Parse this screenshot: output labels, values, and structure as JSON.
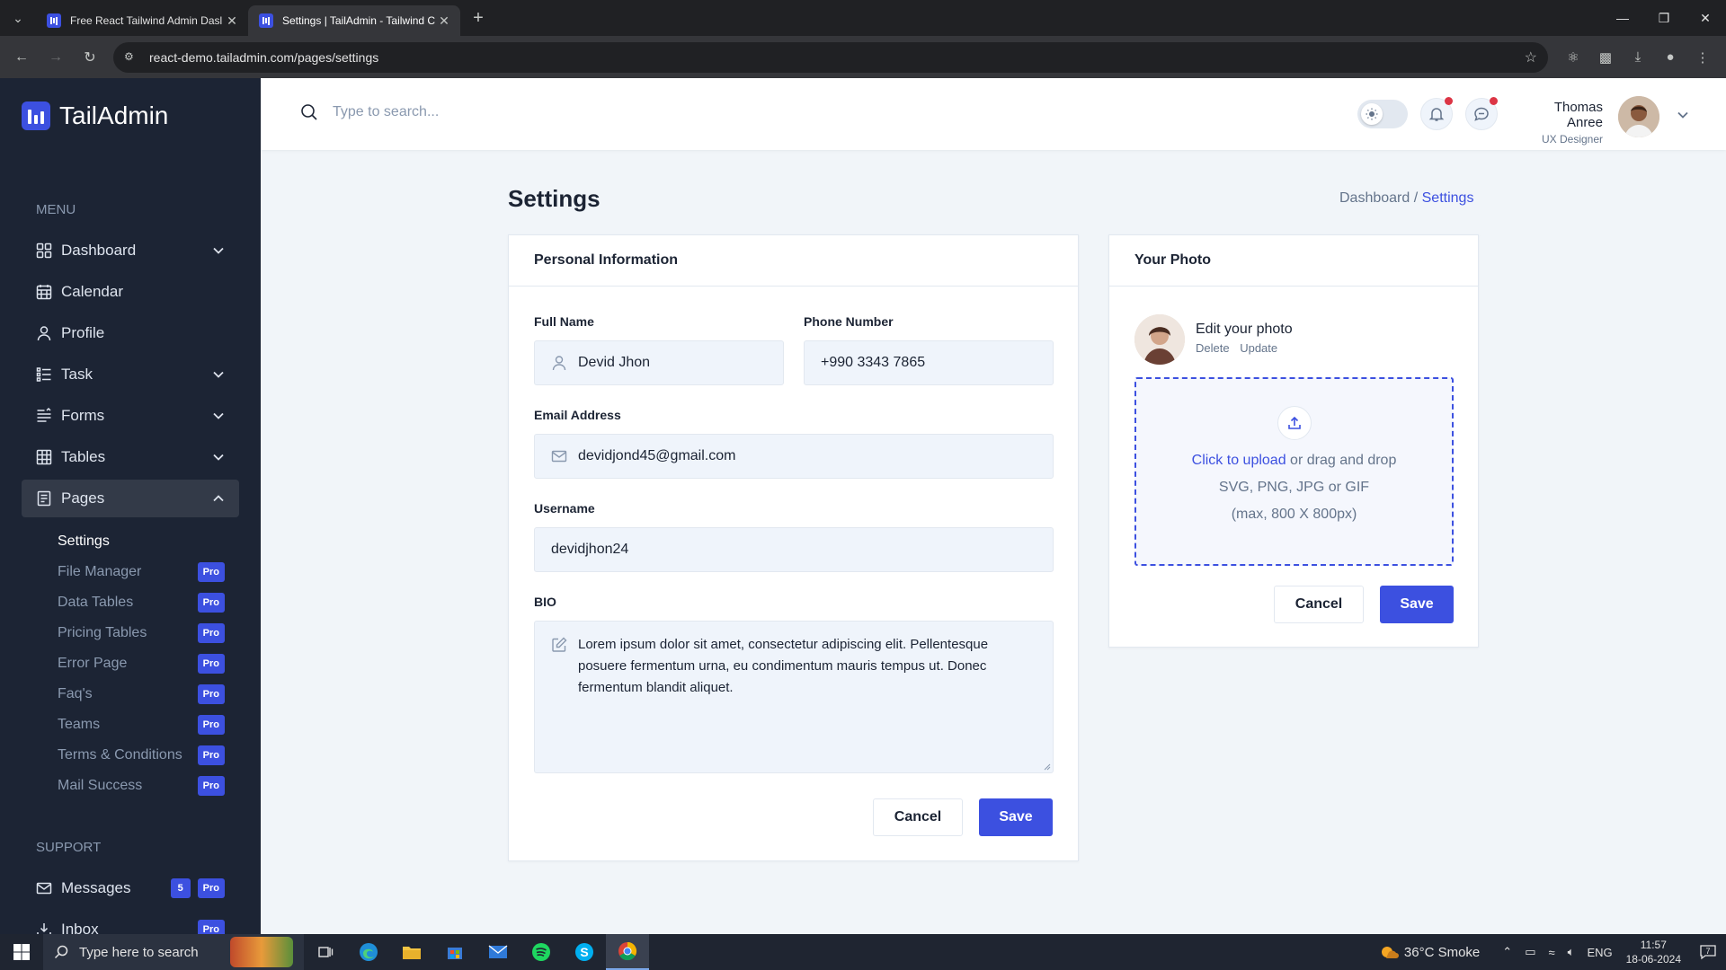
{
  "browser": {
    "tabs": [
      {
        "title": "Free React Tailwind Admin Dasl",
        "active": false
      },
      {
        "title": "Settings | TailAdmin - Tailwind C",
        "active": true
      }
    ],
    "url": "react-demo.tailadmin.com/pages/settings"
  },
  "brand": {
    "name": "TailAdmin",
    "accent": "#3c50e0"
  },
  "sidebar": {
    "menu_heading": "MENU",
    "items": [
      {
        "label": "Dashboard",
        "icon": "grid-icon",
        "chevron": "down"
      },
      {
        "label": "Calendar",
        "icon": "calendar-icon",
        "chevron": ""
      },
      {
        "label": "Profile",
        "icon": "user-icon",
        "chevron": ""
      },
      {
        "label": "Task",
        "icon": "list-icon",
        "chevron": "down"
      },
      {
        "label": "Forms",
        "icon": "forms-icon",
        "chevron": "down"
      },
      {
        "label": "Tables",
        "icon": "table-icon",
        "chevron": "down"
      },
      {
        "label": "Pages",
        "icon": "pages-icon",
        "chevron": "up"
      }
    ],
    "sub_items": [
      {
        "label": "Settings",
        "badge": ""
      },
      {
        "label": "File Manager",
        "badge": "Pro"
      },
      {
        "label": "Data Tables",
        "badge": "Pro"
      },
      {
        "label": "Pricing Tables",
        "badge": "Pro"
      },
      {
        "label": "Error Page",
        "badge": "Pro"
      },
      {
        "label": "Faq's",
        "badge": "Pro"
      },
      {
        "label": "Teams",
        "badge": "Pro"
      },
      {
        "label": "Terms & Conditions",
        "badge": "Pro"
      },
      {
        "label": "Mail Success",
        "badge": "Pro"
      }
    ],
    "support_heading": "SUPPORT",
    "support_items": [
      {
        "label": "Messages",
        "count": "5",
        "badge": "Pro"
      },
      {
        "label": "Inbox",
        "badge": "Pro"
      }
    ]
  },
  "header": {
    "search_placeholder": "Type to search...",
    "user_name": "Thomas Anree",
    "user_role": "UX Designer"
  },
  "page": {
    "title": "Settings",
    "breadcrumb_parent": "Dashboard /",
    "breadcrumb_current": "Settings"
  },
  "personal": {
    "heading": "Personal Information",
    "full_name_label": "Full Name",
    "full_name": "Devid Jhon",
    "phone_label": "Phone Number",
    "phone": "+990 3343 7865",
    "email_label": "Email Address",
    "email": "devidjond45@gmail.com",
    "username_label": "Username",
    "username": "devidjhon24",
    "bio_label": "BIO",
    "bio": "Lorem ipsum dolor sit amet, consectetur adipiscing elit. Pellentesque posuere fermentum urna, eu condimentum mauris tempus ut. Donec fermentum blandit aliquet.",
    "cancel": "Cancel",
    "save": "Save"
  },
  "photo": {
    "heading": "Your Photo",
    "edit_title": "Edit your photo",
    "delete": "Delete",
    "update": "Update",
    "upload_link": "Click to upload",
    "upload_rest": "or drag and drop",
    "formats": "SVG, PNG, JPG or GIF",
    "max_size": "(max, 800 X 800px)",
    "cancel": "Cancel",
    "save": "Save"
  },
  "taskbar": {
    "search_placeholder": "Type here to search",
    "weather": "36°C  Smoke",
    "lang": "ENG",
    "time": "11:57",
    "date": "18-06-2024",
    "notifications": "7"
  }
}
